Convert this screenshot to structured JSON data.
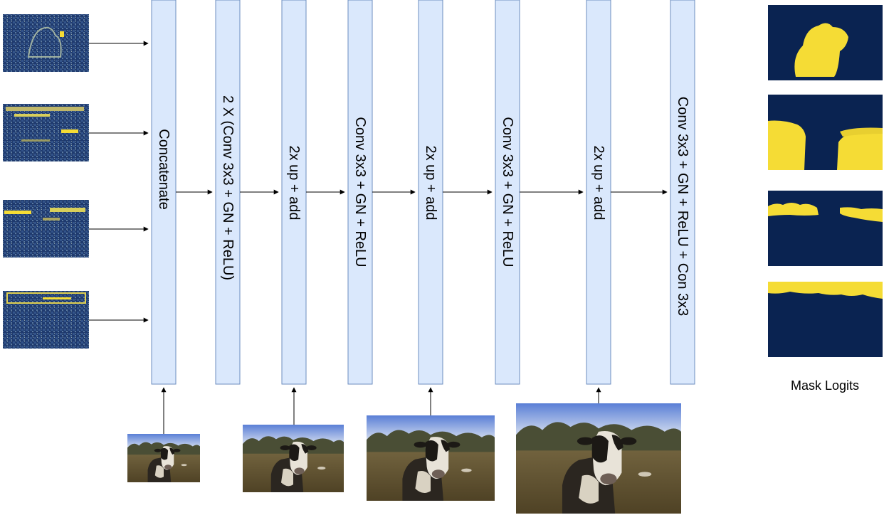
{
  "blocks": [
    {
      "label": "Concatenate"
    },
    {
      "label": "2 X (Conv 3x3 + GN + ReLU)"
    },
    {
      "label": "2x up + add"
    },
    {
      "label": "Conv 3x3 + GN + ReLU"
    },
    {
      "label": "2x up + add"
    },
    {
      "label": "Conv 3x3 + GN + ReLU"
    },
    {
      "label": "2x up + add"
    },
    {
      "label": "Conv 3x3 + GN + ReLU + Con 3x3"
    }
  ],
  "feature_maps": [
    {
      "name": "feature-map-1"
    },
    {
      "name": "feature-map-2"
    },
    {
      "name": "feature-map-3"
    },
    {
      "name": "feature-map-4"
    }
  ],
  "cow_images": [
    {
      "name": "cow-image-small"
    },
    {
      "name": "cow-image-medium"
    },
    {
      "name": "cow-image-large"
    },
    {
      "name": "cow-image-xlarge"
    }
  ],
  "masks": [
    {
      "name": "mask-cow"
    },
    {
      "name": "mask-field"
    },
    {
      "name": "mask-treeline"
    },
    {
      "name": "mask-sky"
    }
  ],
  "mask_caption": "Mask Logits",
  "colors": {
    "block_fill": "#dae8fc",
    "block_stroke": "#6c8ebf",
    "mask_background": "#0a2351",
    "mask_highlight": "#f5dc35"
  }
}
